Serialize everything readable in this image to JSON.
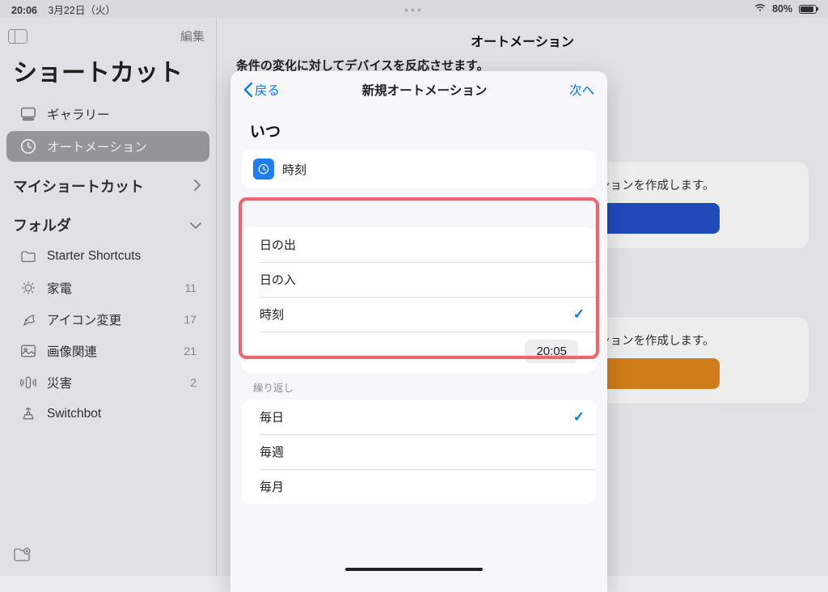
{
  "status": {
    "time": "20:06",
    "date_label": "3月22日（火）",
    "battery_label": "80%"
  },
  "sidebar": {
    "edit_label": "編集",
    "title": "ショートカット",
    "gallery_label": "ギャラリー",
    "automation_label": "オートメーション",
    "my_shortcuts_label": "マイショートカット",
    "folders_label": "フォルダ",
    "folders": [
      {
        "name": "Starter Shortcuts",
        "count": ""
      },
      {
        "name": "家電",
        "count": "11"
      },
      {
        "name": "アイコン変更",
        "count": "17"
      },
      {
        "name": "画像関連",
        "count": "21"
      },
      {
        "name": "災害",
        "count": "2"
      },
      {
        "name": "Switchbot",
        "count": ""
      }
    ]
  },
  "main": {
    "header": "オートメーション",
    "subtitle": "条件の変化に対してデバイスを反応させます。",
    "stub_label": "ションを作成します。"
  },
  "sheet": {
    "back_label": "戻る",
    "title": "新規オートメーション",
    "next_label": "次へ",
    "when_label": "いつ",
    "time_row_label": "時刻",
    "options": [
      {
        "label": "日の出",
        "checked": false
      },
      {
        "label": "日の入",
        "checked": false
      },
      {
        "label": "時刻",
        "checked": true
      }
    ],
    "time_value": "20:05",
    "repeat_label": "繰り返し",
    "repeat": [
      {
        "label": "毎日",
        "checked": true
      },
      {
        "label": "毎週",
        "checked": false
      },
      {
        "label": "毎月",
        "checked": false
      }
    ]
  }
}
